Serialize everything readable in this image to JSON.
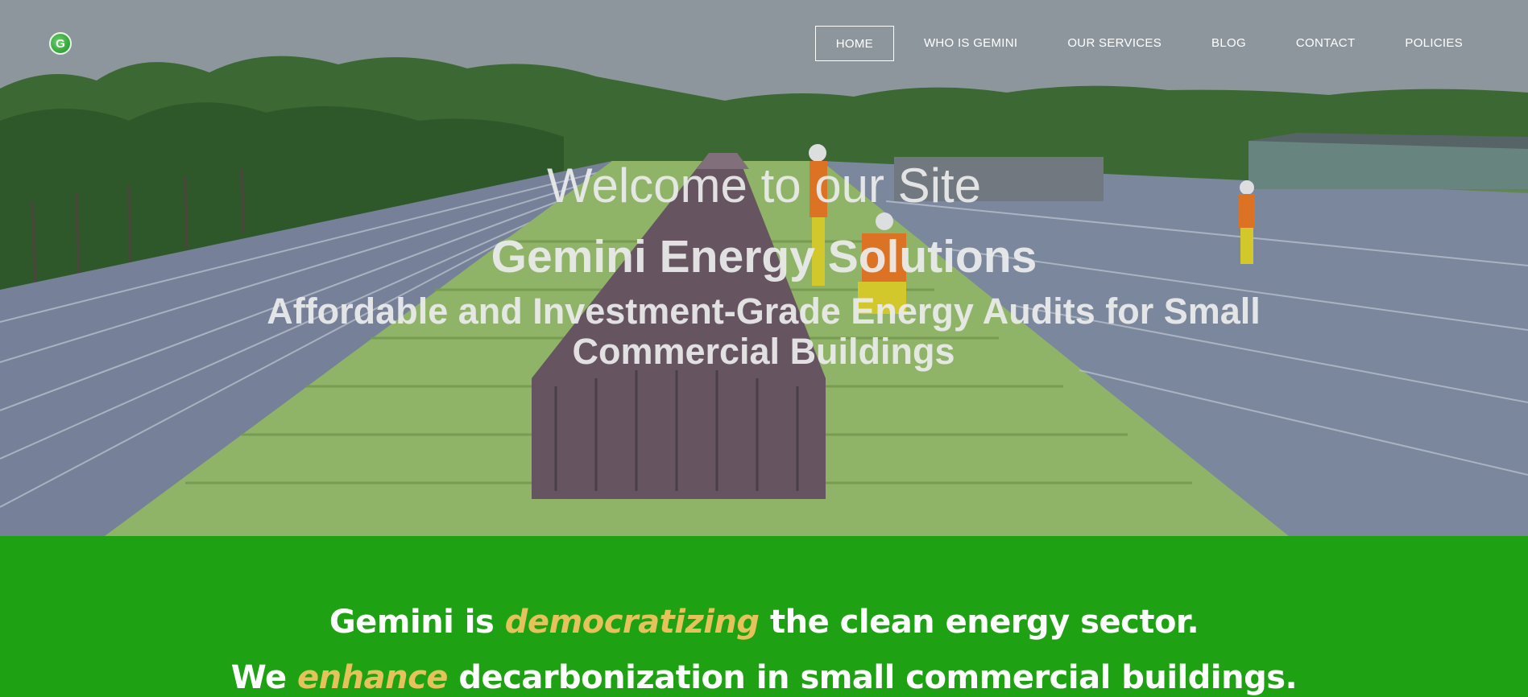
{
  "site": {
    "logo_letter": "G"
  },
  "nav": {
    "items": [
      {
        "label": "HOME",
        "active": true
      },
      {
        "label": "WHO IS GEMINI"
      },
      {
        "label": "OUR SERVICES"
      },
      {
        "label": "BLOG"
      },
      {
        "label": "CONTACT"
      },
      {
        "label": "POLICIES"
      }
    ]
  },
  "hero": {
    "welcome": "Welcome to our Site",
    "company": "Gemini Energy Solutions",
    "tagline": "Affordable and Investment-Grade Energy Audits for Small Commercial Buildings"
  },
  "mission": {
    "line1": {
      "before": "Gemini is ",
      "emphasis": "democratizing",
      "after": " the clean energy sector."
    },
    "line2": {
      "before": "We ",
      "emphasis": "enhance",
      "after": " decarbonization in small commercial buildings."
    }
  },
  "colors": {
    "green_band": "#1fa114",
    "emphasis_gold": "#e6c35a",
    "nav_text": "#ffffff"
  }
}
